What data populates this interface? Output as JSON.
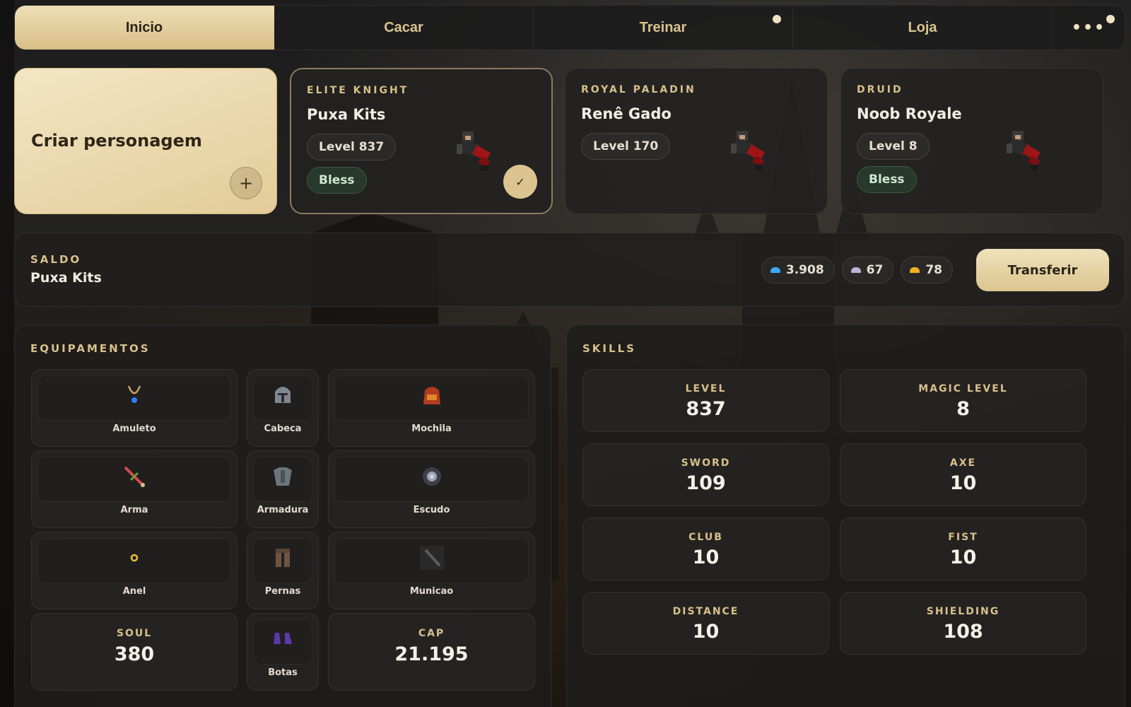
{
  "nav": {
    "tabs": [
      {
        "label": "Inicio",
        "active": true,
        "dot": false
      },
      {
        "label": "Cacar",
        "active": false,
        "dot": false
      },
      {
        "label": "Treinar",
        "active": false,
        "dot": true
      },
      {
        "label": "Loja",
        "active": false,
        "dot": false
      }
    ],
    "more_label": "•••",
    "more_has_dot": true
  },
  "create_card": {
    "title": "Criar personagem",
    "plus_label": "+"
  },
  "characters": [
    {
      "vocation": "ELITE KNIGHT",
      "name": "Puxa Kits",
      "level": "Level 837",
      "bless": "Bless",
      "selected": true,
      "check": "✓"
    },
    {
      "vocation": "ROYAL PALADIN",
      "name": "Renê Gado",
      "level": "Level 170",
      "bless": null,
      "selected": false
    },
    {
      "vocation": "DRUID",
      "name": "Noob Royale",
      "level": "Level 8",
      "bless": "Bless",
      "selected": false
    }
  ],
  "balance": {
    "label": "SALDO",
    "name": "Puxa Kits",
    "coins": [
      {
        "icon": "blue-coin-icon",
        "color": "#3fa9ff",
        "value": "3.908"
      },
      {
        "icon": "silver-coin-icon",
        "color": "#b9b4d6",
        "value": "67"
      },
      {
        "icon": "gold-coin-icon",
        "color": "#f2b022",
        "value": "78"
      }
    ],
    "transfer_label": "Transferir"
  },
  "equipment": {
    "title": "EQUIPAMENTOS",
    "slots": {
      "amulet": {
        "label": "Amuleto",
        "icon": "amulet-icon"
      },
      "head": {
        "label": "Cabeca",
        "icon": "helmet-icon"
      },
      "backpack": {
        "label": "Mochila",
        "icon": "backpack-icon"
      },
      "weapon": {
        "label": "Arma",
        "icon": "sword-icon"
      },
      "armor": {
        "label": "Armadura",
        "icon": "armor-icon"
      },
      "shield": {
        "label": "Escudo",
        "icon": "shield-icon"
      },
      "ring": {
        "label": "Anel",
        "icon": "ring-icon"
      },
      "legs": {
        "label": "Pernas",
        "icon": "legs-icon"
      },
      "ammo": {
        "label": "Municao",
        "icon": "ammo-icon"
      },
      "boots": {
        "label": "Botas",
        "icon": "boots-icon"
      }
    },
    "soul": {
      "label": "SOUL",
      "value": "380"
    },
    "cap": {
      "label": "CAP",
      "value": "21.195"
    }
  },
  "skills": {
    "title": "SKILLS",
    "items": [
      {
        "label": "LEVEL",
        "value": "837"
      },
      {
        "label": "MAGIC LEVEL",
        "value": "8"
      },
      {
        "label": "SWORD",
        "value": "109"
      },
      {
        "label": "AXE",
        "value": "10"
      },
      {
        "label": "CLUB",
        "value": "10"
      },
      {
        "label": "FIST",
        "value": "10"
      },
      {
        "label": "DISTANCE",
        "value": "10"
      },
      {
        "label": "SHIELDING",
        "value": "108"
      }
    ]
  }
}
